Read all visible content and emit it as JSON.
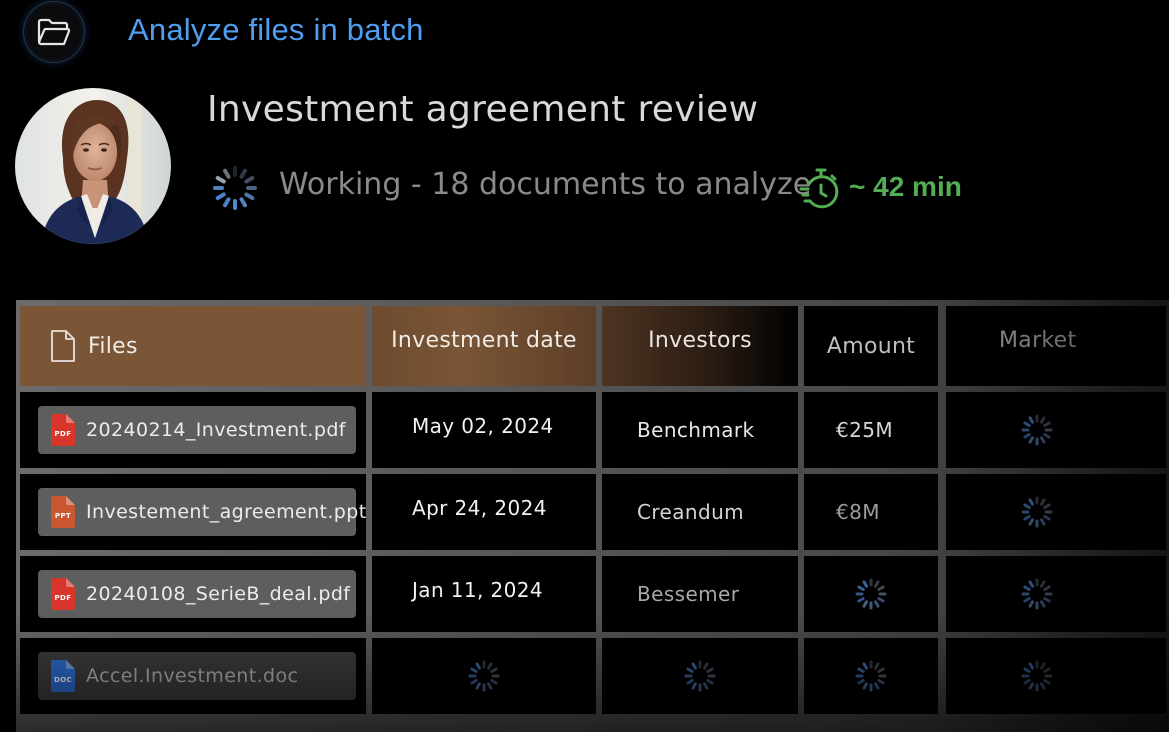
{
  "batch": {
    "title": "Analyze files in batch",
    "icon": "folder-open-icon"
  },
  "task": {
    "title": "Investment agreement review",
    "status": "Working - 18 documents to analyze",
    "eta": "~ 42 min",
    "eta_icon": "timer-icon",
    "avatar": "avatar-photo"
  },
  "colors": {
    "accent_blue": "#4f9ef0",
    "eta_green": "#52ad55",
    "header_brown": "#7a5536",
    "file_pill": "#5e5e5e"
  },
  "table": {
    "columns": [
      {
        "label": "Files",
        "icon": "file-icon"
      },
      {
        "label": "Investment date"
      },
      {
        "label": "Investors"
      },
      {
        "label": "Amount"
      },
      {
        "label": "Market"
      }
    ],
    "rows": [
      {
        "file": "20240214_Investment.pdf",
        "type": "PDF",
        "type_color": "#d9362b",
        "date": "May 02, 2024",
        "investors": "Benchmark",
        "amount": "€25M",
        "market": null
      },
      {
        "file": "Investement_agreement.ppt",
        "type": "PPT",
        "type_color": "#c9572f",
        "date": "Apr 24, 2024",
        "investors": "Creandum",
        "amount": "€8M",
        "market": null
      },
      {
        "file": "20240108_SerieB_deal.pdf",
        "type": "PDF",
        "type_color": "#d9362b",
        "date": "Jan 11, 2024",
        "investors": "Bessemer",
        "amount": null,
        "market": null
      },
      {
        "file": "Accel.Investment.doc",
        "type": "DOC",
        "type_color": "#2f6fd8",
        "date": null,
        "investors": null,
        "amount": null,
        "market": null
      }
    ]
  }
}
